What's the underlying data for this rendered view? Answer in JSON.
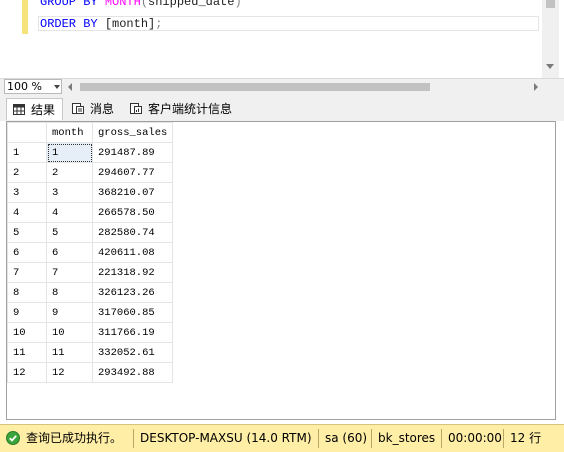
{
  "editor": {
    "line1": {
      "kw1": "GROUP BY",
      "fn": "MONTH",
      "open": "(",
      "arg": "shipped_date",
      "close": ")"
    },
    "line2": {
      "kw": "ORDER BY",
      "col": "[month]",
      "end": ";"
    }
  },
  "zoom": {
    "value": "100 %"
  },
  "tabs": [
    {
      "label": "结果",
      "icon": "grid-icon"
    },
    {
      "label": "消息",
      "icon": "messages-icon"
    },
    {
      "label": "客户端统计信息",
      "icon": "client-stats-icon"
    }
  ],
  "grid": {
    "columns": [
      "month",
      "gross_sales"
    ],
    "rows": [
      {
        "n": "1",
        "month": "1",
        "gross_sales": "291487.89"
      },
      {
        "n": "2",
        "month": "2",
        "gross_sales": "294607.77"
      },
      {
        "n": "3",
        "month": "3",
        "gross_sales": "368210.07"
      },
      {
        "n": "4",
        "month": "4",
        "gross_sales": "266578.50"
      },
      {
        "n": "5",
        "month": "5",
        "gross_sales": "282580.74"
      },
      {
        "n": "6",
        "month": "6",
        "gross_sales": "420611.08"
      },
      {
        "n": "7",
        "month": "7",
        "gross_sales": "221318.92"
      },
      {
        "n": "8",
        "month": "8",
        "gross_sales": "326123.26"
      },
      {
        "n": "9",
        "month": "9",
        "gross_sales": "317060.85"
      },
      {
        "n": "10",
        "month": "10",
        "gross_sales": "311766.19"
      },
      {
        "n": "11",
        "month": "11",
        "gross_sales": "332052.61"
      },
      {
        "n": "12",
        "month": "12",
        "gross_sales": "293492.88"
      }
    ]
  },
  "status": {
    "message": "查询已成功执行。",
    "server": "DESKTOP-MAXSU (14.0 RTM)",
    "user": "sa (60)",
    "database": "bk_stores",
    "elapsed": "00:00:00",
    "rows": "12 行",
    "icon": "success-check-icon",
    "color": "#ffeea6"
  }
}
